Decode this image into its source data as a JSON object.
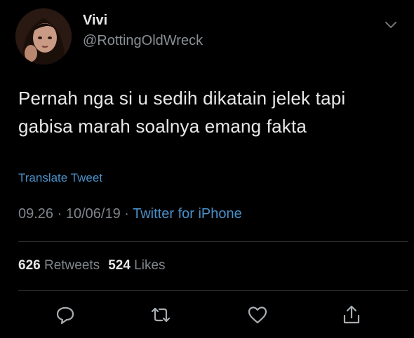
{
  "author": {
    "display_name": "Vivi",
    "username": "@RottingOldWreck"
  },
  "tweet": {
    "text_line1": "Pernah nga si u sedih dikatain jelek tapi",
    "text_line2": "gabisa marah soalnya emang fakta",
    "translate_label": "Translate Tweet"
  },
  "meta": {
    "time": "09.26",
    "separator1": " · ",
    "date": "10/06/19",
    "separator2": " · ",
    "source": "Twitter for iPhone"
  },
  "stats": {
    "retweets_count": "626",
    "retweets_label": "Retweets",
    "likes_count": "524",
    "likes_label": "Likes"
  },
  "icons": {
    "reply": "reply-icon",
    "retweet": "retweet-icon",
    "like": "heart-icon",
    "share": "share-icon",
    "menu": "chevron-down-icon"
  },
  "colors": {
    "background": "#000000",
    "link": "#4a90c9",
    "muted": "#7f858a",
    "text": "#e8e8e8"
  }
}
